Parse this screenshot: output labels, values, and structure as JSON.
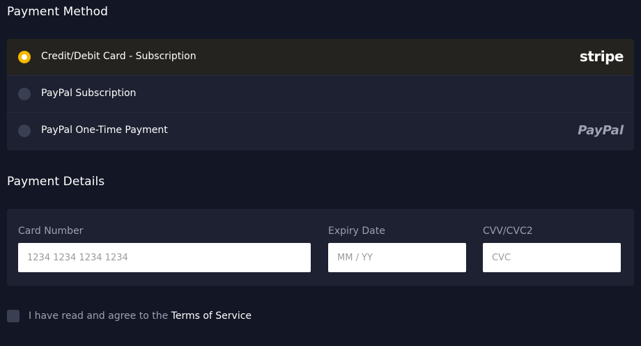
{
  "payment_method": {
    "title": "Payment Method",
    "options": [
      {
        "label": "Credit/Debit Card - Subscription",
        "selected": true,
        "brand": "stripe"
      },
      {
        "label": "PayPal Subscription",
        "selected": false,
        "brand": ""
      },
      {
        "label": "PayPal One-Time Payment",
        "selected": false,
        "brand": "PayPal"
      }
    ]
  },
  "payment_details": {
    "title": "Payment Details",
    "card_number": {
      "label": "Card Number",
      "placeholder": "1234 1234 1234 1234",
      "value": ""
    },
    "expiry": {
      "label": "Expiry Date",
      "placeholder": "MM / YY",
      "value": ""
    },
    "cvv": {
      "label": "CVV/CVC2",
      "placeholder": "CVC",
      "value": ""
    }
  },
  "agreement": {
    "text": "I have read and agree to the",
    "link": "Terms of Service",
    "checked": false
  },
  "colors": {
    "background": "#131624",
    "panel": "#1d2131",
    "selected_row": "#25231f",
    "accent": "#f5b800",
    "muted_text": "#9ba0b1"
  }
}
